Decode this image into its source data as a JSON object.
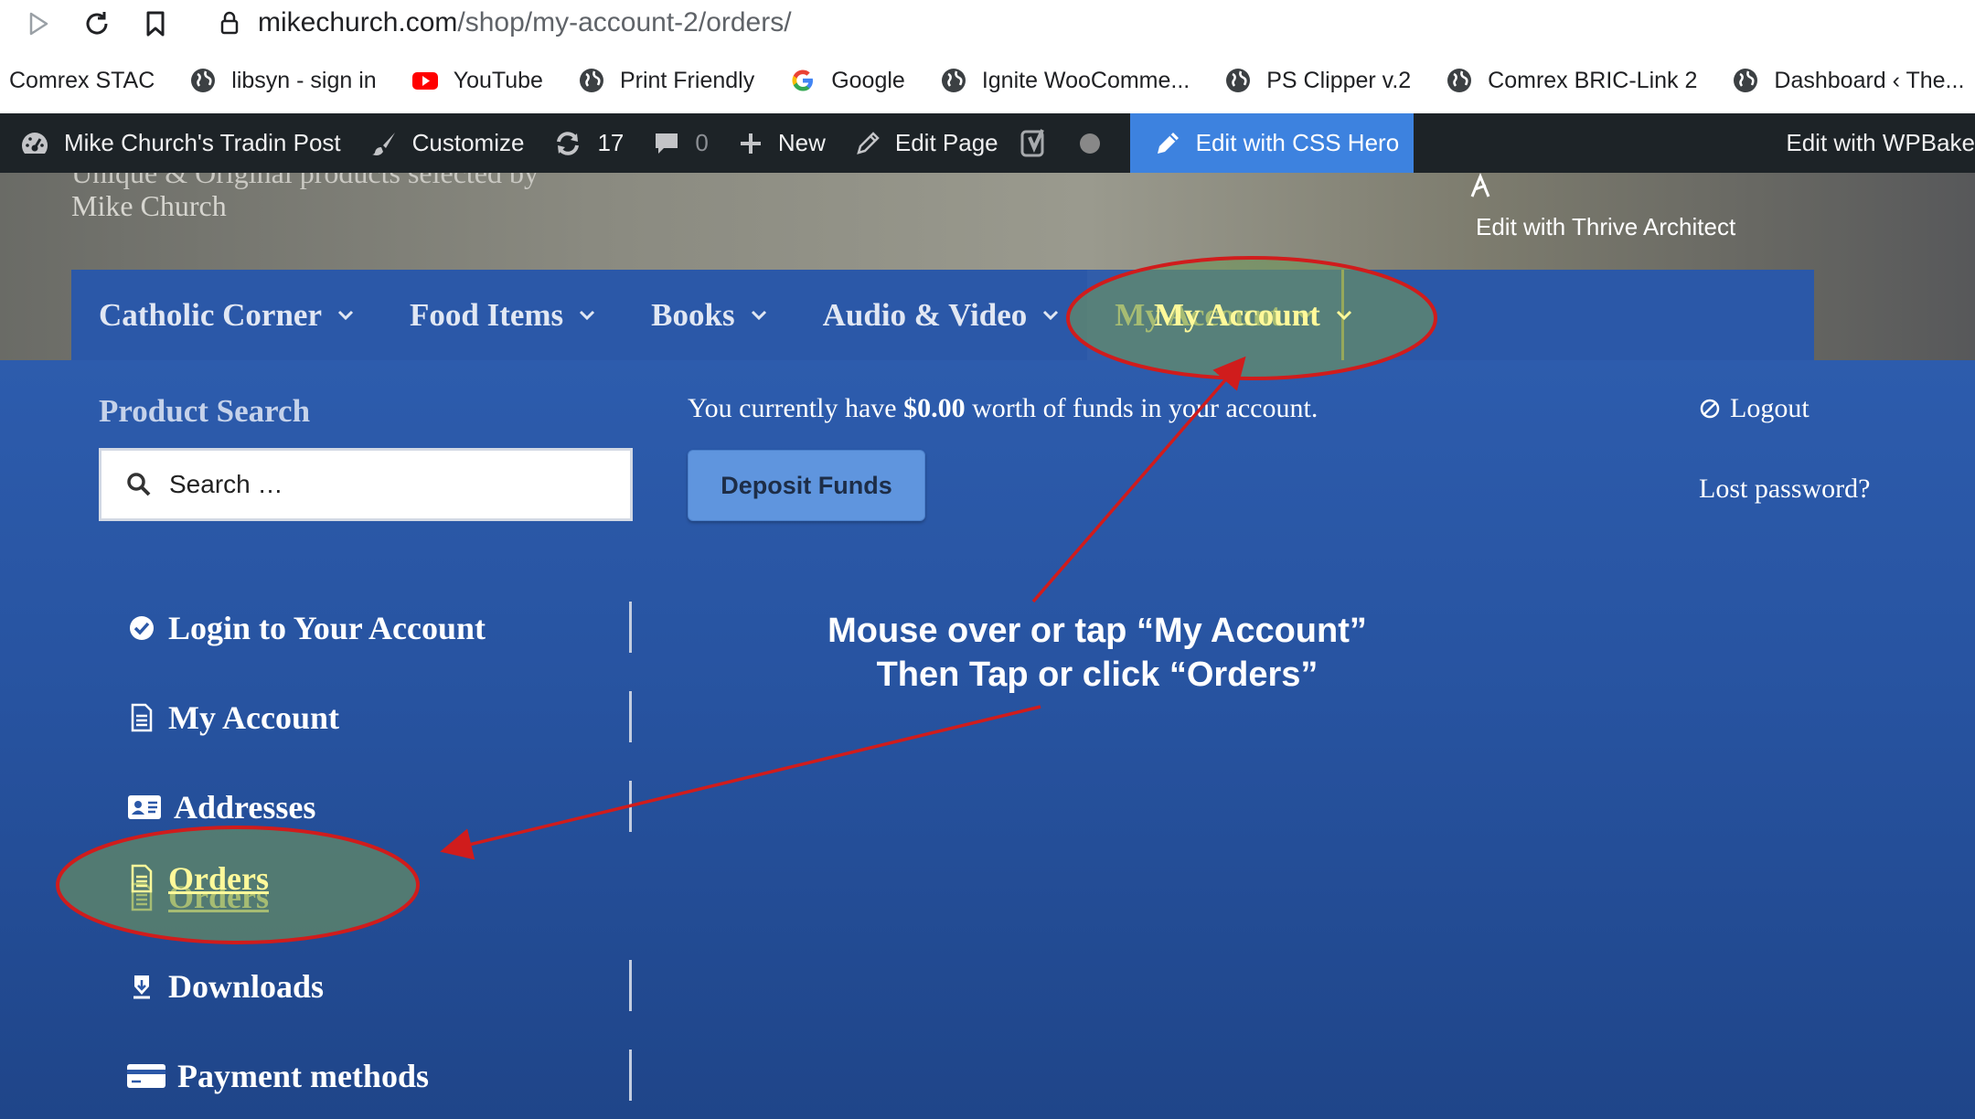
{
  "browser": {
    "url_domain": "mikechurch.com",
    "url_path": "/shop/my-account-2/orders/",
    "bookmarks": [
      {
        "label": "Comrex STAC",
        "icon": "none"
      },
      {
        "label": "libsyn - sign in",
        "icon": "globe-icon"
      },
      {
        "label": "YouTube",
        "icon": "youtube-icon"
      },
      {
        "label": "Print Friendly",
        "icon": "globe-icon"
      },
      {
        "label": "Google",
        "icon": "google-icon"
      },
      {
        "label": "Ignite WooComme...",
        "icon": "globe-icon"
      },
      {
        "label": "PS Clipper v.2",
        "icon": "globe-icon"
      },
      {
        "label": "Comrex BRIC-Link 2",
        "icon": "globe-icon"
      },
      {
        "label": "Dashboard ‹ The...",
        "icon": "globe-icon"
      }
    ]
  },
  "adminbar": {
    "site_name": "Mike Church's Tradin Post",
    "customize": "Customize",
    "updates_count": "17",
    "comments_count": "0",
    "new_label": "New",
    "edit_page": "Edit Page",
    "css_hero": "Edit with CSS Hero",
    "wpbakery": "Edit with WPBake",
    "thrive": "Edit with Thrive Architect"
  },
  "header": {
    "tagline_line1": "Unique & Original products selected by",
    "tagline_line2": "Mike Church"
  },
  "mainnav": {
    "items": [
      {
        "label": "Catholic Corner"
      },
      {
        "label": "Food Items"
      },
      {
        "label": "Books"
      },
      {
        "label": "Audio & Video"
      },
      {
        "label": "My Account"
      }
    ]
  },
  "sidebar": {
    "search_title": "Product Search",
    "search_placeholder": "Search …"
  },
  "funds": {
    "prefix": "You currently have ",
    "amount": "$0.00",
    "suffix": " worth of funds in your account.",
    "deposit_label": "Deposit Funds"
  },
  "account_links": {
    "logout": "Logout",
    "lost_password": "Lost password?"
  },
  "account_nav": {
    "items": [
      {
        "label": "Login to Your Account",
        "icon": "check-circle-icon"
      },
      {
        "label": "My Account",
        "icon": "document-icon"
      },
      {
        "label": "Addresses",
        "icon": "address-card-icon"
      },
      {
        "label": "Orders",
        "icon": "document-icon"
      },
      {
        "label": "Downloads",
        "icon": "download-icon"
      },
      {
        "label": "Payment methods",
        "icon": "credit-card-icon"
      }
    ]
  },
  "annotation": {
    "line1": "Mouse over or tap “My Account”",
    "line2": "Then Tap or click “Orders”",
    "color": "#d01c1c"
  }
}
